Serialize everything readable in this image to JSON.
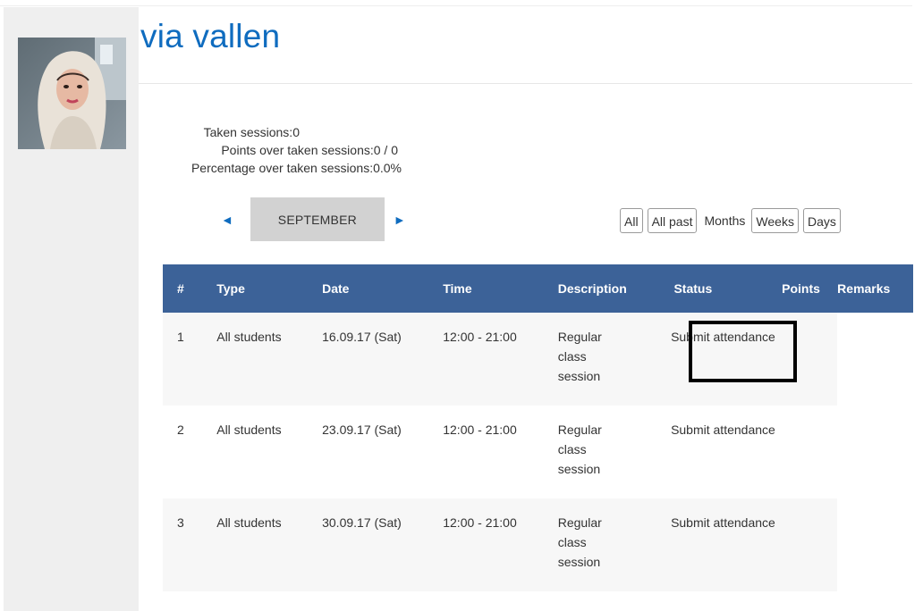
{
  "profile": {
    "name": "via vallen"
  },
  "summary": {
    "taken_sessions": "Taken sessions:0",
    "points_over_taken": "Points over taken sessions:0 / 0",
    "percentage_over_taken": "Percentage over taken sessions:0.0%"
  },
  "month_nav": {
    "prev_icon": "◄",
    "next_icon": "►",
    "month_label": "SEPTEMBER"
  },
  "filters": {
    "all": "All",
    "all_past": "All past",
    "months": "Months",
    "weeks": "Weeks",
    "days": "Days"
  },
  "table": {
    "headers": [
      "#",
      "Type",
      "Date",
      "Time",
      "Description",
      "Status",
      "Points",
      "Remarks"
    ],
    "rows": [
      {
        "num": "1",
        "type": "All students",
        "date": "16.09.17 (Sat)",
        "time": "12:00 - 21:00",
        "description": "Regular class session",
        "status": "Submit attendance",
        "points": "",
        "remarks": ""
      },
      {
        "num": "2",
        "type": "All students",
        "date": "23.09.17 (Sat)",
        "time": "12:00 - 21:00",
        "description": "Regular class session",
        "status": "Submit attendance",
        "points": "",
        "remarks": ""
      },
      {
        "num": "3",
        "type": "All students",
        "date": "30.09.17 (Sat)",
        "time": "12:00 - 21:00",
        "description": "Regular class session",
        "status": "Submit attendance",
        "points": "",
        "remarks": ""
      }
    ]
  },
  "colors": {
    "header_bg": "#3c6298",
    "name_blue": "#0f6cbf",
    "sidebar_bg": "#efefef",
    "month_btn_bg": "#d2d2d2",
    "row_alt": "#f7f7f7"
  }
}
